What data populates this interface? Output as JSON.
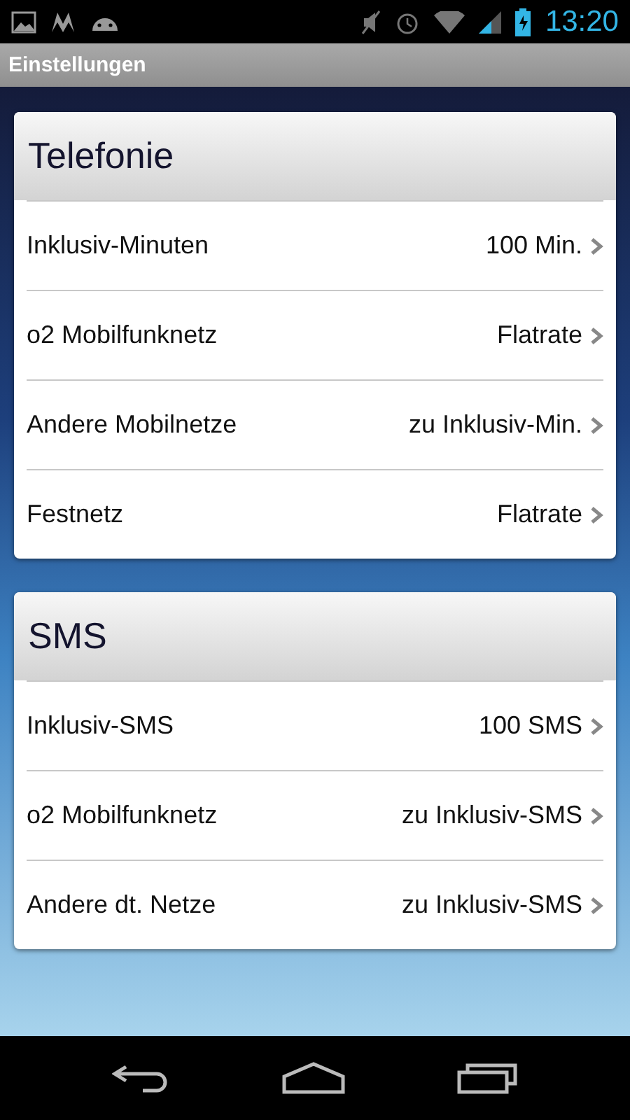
{
  "status_bar": {
    "time": "13:20"
  },
  "action_bar": {
    "title": "Einstellungen"
  },
  "sections": [
    {
      "title": "Telefonie",
      "rows": [
        {
          "label": "Inklusiv-Minuten",
          "value": "100 Min."
        },
        {
          "label": "o2 Mobilfunknetz",
          "value": "Flatrate"
        },
        {
          "label": "Andere Mobilnetze",
          "value": "zu Inklusiv-Min."
        },
        {
          "label": "Festnetz",
          "value": "Flatrate"
        }
      ]
    },
    {
      "title": "SMS",
      "rows": [
        {
          "label": "Inklusiv-SMS",
          "value": "100 SMS"
        },
        {
          "label": "o2 Mobilfunknetz",
          "value": "zu Inklusiv-SMS"
        },
        {
          "label": "Andere dt. Netze",
          "value": "zu Inklusiv-SMS"
        }
      ]
    }
  ]
}
